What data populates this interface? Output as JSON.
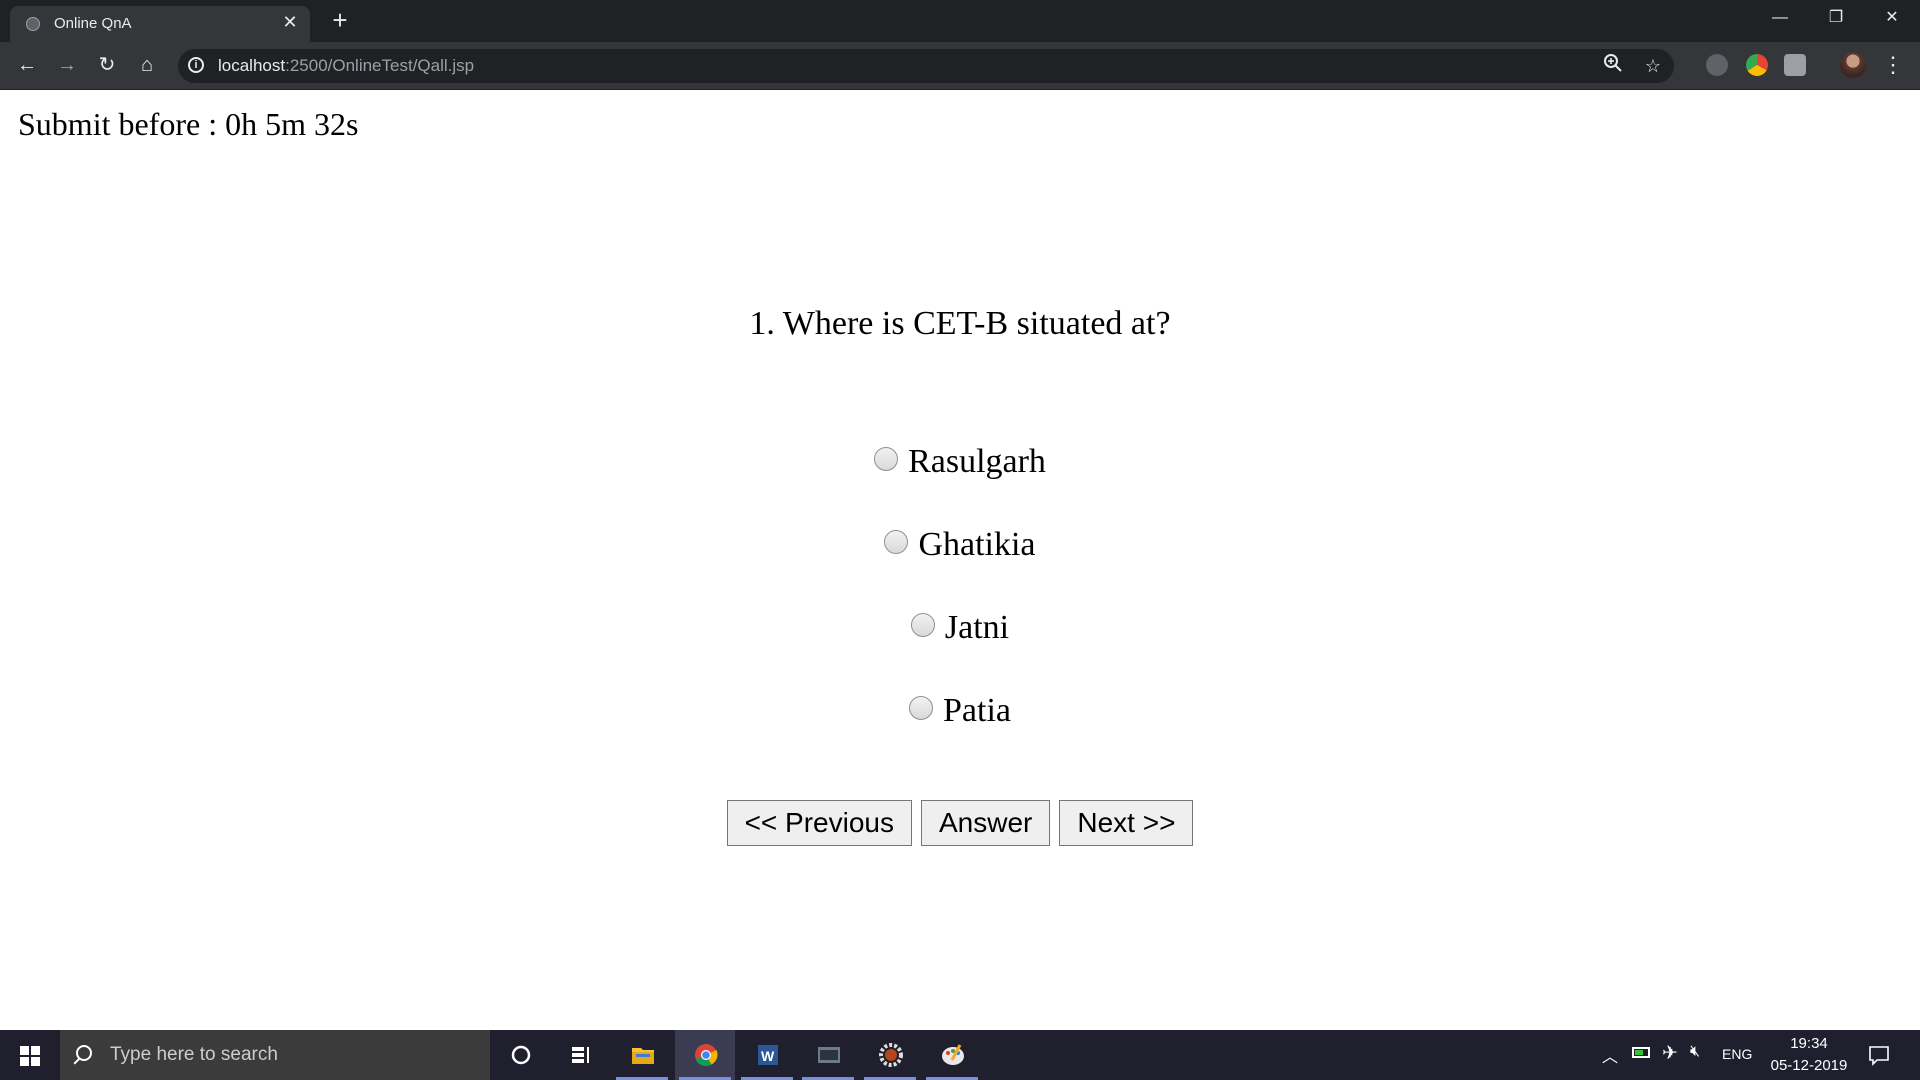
{
  "browser": {
    "tab_title": "Online QnA",
    "tab_close": "✕",
    "new_tab": "+",
    "url_host": "localhost",
    "url_path": ":2500/OnlineTest/Qall.jsp",
    "window_controls": {
      "minimize": "—",
      "maximize": "❐",
      "close": "✕"
    },
    "nav": {
      "back": "←",
      "forward": "→",
      "reload": "↻",
      "home": "⌂"
    },
    "icons": {
      "zoom": "zoom-icon",
      "star": "bookmark-star-icon",
      "menu": "⋮"
    }
  },
  "page": {
    "timer_text": "Submit before : 0h 5m 32s",
    "question": "1. Where is CET-B situated at?",
    "options": [
      {
        "label": "Rasulgarh",
        "selected": false
      },
      {
        "label": "Ghatikia",
        "selected": false
      },
      {
        "label": "Jatni",
        "selected": false
      },
      {
        "label": "Patia",
        "selected": false
      }
    ],
    "buttons": {
      "previous": "<< Previous",
      "answer": "Answer",
      "next": "Next >>"
    }
  },
  "taskbar": {
    "search_placeholder": "Type here to search",
    "language": "ENG",
    "time": "19:34",
    "date": "05-12-2019",
    "accent": "#7a8fd6"
  }
}
